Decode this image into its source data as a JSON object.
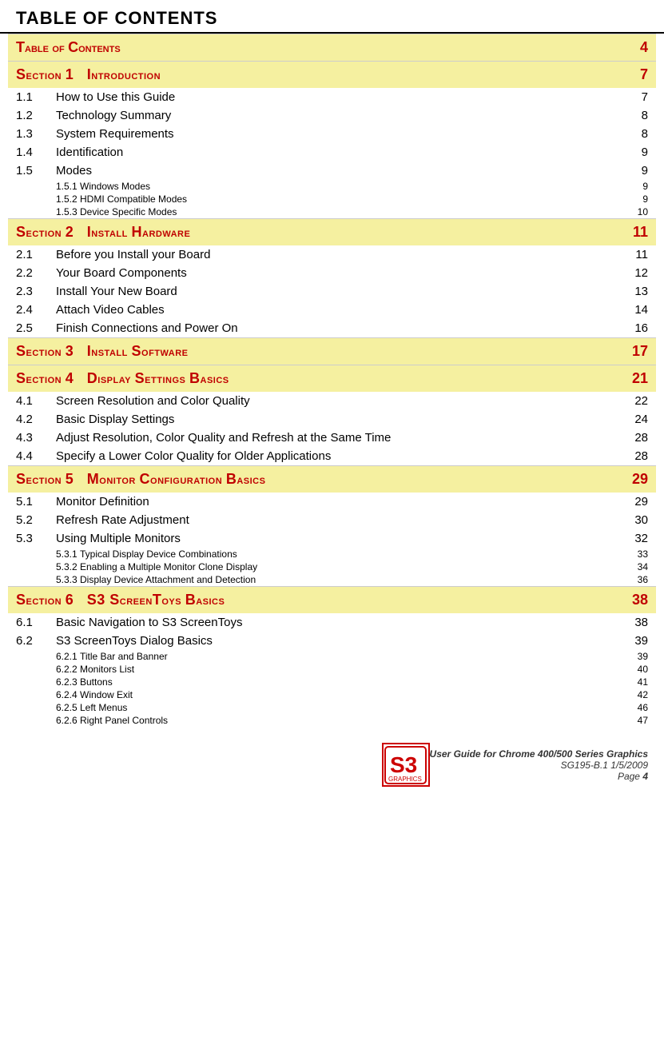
{
  "pageHeader": {
    "title": "TABLE OF CONTENTS"
  },
  "toc": {
    "label": "Table of Contents",
    "page": "4"
  },
  "sections": [
    {
      "id": "section1",
      "label": "Section 1",
      "title": "Introduction",
      "page": "7",
      "entries": [
        {
          "num": "1.1",
          "text": "How to Use this Guide",
          "page": "7"
        },
        {
          "num": "1.2",
          "text": "Technology Summary",
          "page": "8"
        },
        {
          "num": "1.3",
          "text": "System Requirements",
          "page": "8"
        },
        {
          "num": "1.4",
          "text": "Identification",
          "page": "9"
        },
        {
          "num": "1.5",
          "text": "Modes",
          "page": "9",
          "subEntries": [
            {
              "num": "1.5.1",
              "text": "Windows Modes",
              "page": "9"
            },
            {
              "num": "1.5.2",
              "text": "HDMI Compatible Modes",
              "page": "9"
            },
            {
              "num": "1.5.3",
              "text": "Device Specific Modes",
              "page": "10"
            }
          ]
        }
      ]
    },
    {
      "id": "section2",
      "label": "Section 2",
      "title": "Install Hardware",
      "page": "11",
      "entries": [
        {
          "num": "2.1",
          "text": "Before you Install your Board",
          "page": "11"
        },
        {
          "num": "2.2",
          "text": "Your Board Components",
          "page": "12"
        },
        {
          "num": "2.3",
          "text": "Install Your New Board",
          "page": "13"
        },
        {
          "num": "2.4",
          "text": "Attach Video Cables",
          "page": "14"
        },
        {
          "num": "2.5",
          "text": "Finish Connections and Power On",
          "page": "16"
        }
      ]
    },
    {
      "id": "section3",
      "label": "Section 3",
      "title": "Install Software",
      "page": "17",
      "entries": []
    },
    {
      "id": "section4",
      "label": "Section 4",
      "title": "Display Settings Basics",
      "page": "21",
      "entries": [
        {
          "num": "4.1",
          "text": "Screen Resolution and Color Quality",
          "page": "22"
        },
        {
          "num": "4.2",
          "text": "Basic Display Settings",
          "page": "24"
        },
        {
          "num": "4.3",
          "text": "Adjust Resolution, Color Quality and Refresh at the Same Time",
          "page": "28"
        },
        {
          "num": "4.4",
          "text": "Specify a Lower Color Quality for Older Applications",
          "page": "28"
        }
      ]
    },
    {
      "id": "section5",
      "label": "Section 5",
      "title": "Monitor Configuration Basics",
      "page": "29",
      "entries": [
        {
          "num": "5.1",
          "text": "Monitor Definition",
          "page": "29"
        },
        {
          "num": "5.2",
          "text": "Refresh Rate Adjustment",
          "page": "30"
        },
        {
          "num": "5.3",
          "text": "Using Multiple Monitors",
          "page": "32",
          "subEntries": [
            {
              "num": "5.3.1",
              "text": "Typical Display Device Combinations",
              "page": "33"
            },
            {
              "num": "5.3.2",
              "text": "Enabling a Multiple Monitor Clone Display",
              "page": "34"
            },
            {
              "num": "5.3.3",
              "text": "Display Device Attachment and Detection",
              "page": "36"
            }
          ]
        }
      ]
    },
    {
      "id": "section6",
      "label": "Section 6",
      "title": "S3 ScreenToys Basics",
      "page": "38",
      "entries": [
        {
          "num": "6.1",
          "text": "Basic Navigation to S3 ScreenToys",
          "page": "38"
        },
        {
          "num": "6.2",
          "text": "S3 ScreenToys Dialog Basics",
          "page": "39",
          "subEntries": [
            {
              "num": "6.2.1",
              "text": "Title Bar and Banner",
              "page": "39"
            },
            {
              "num": "6.2.2",
              "text": "Monitors List",
              "page": "40"
            },
            {
              "num": "6.2.3",
              "text": "Buttons",
              "page": "41"
            },
            {
              "num": "6.2.4",
              "text": "Window Exit",
              "page": "42"
            },
            {
              "num": "6.2.5",
              "text": "Left Menus",
              "page": "46"
            },
            {
              "num": "6.2.6",
              "text": "Right Panel Controls",
              "page": "47"
            }
          ]
        }
      ]
    }
  ],
  "footer": {
    "logoText": "S3",
    "docTitle": "User Guide for Chrome 400/500 Series Graphics",
    "docId": "SG195-B.1   1/5/2009",
    "pageLabel": "Page",
    "pageNum": "4"
  }
}
